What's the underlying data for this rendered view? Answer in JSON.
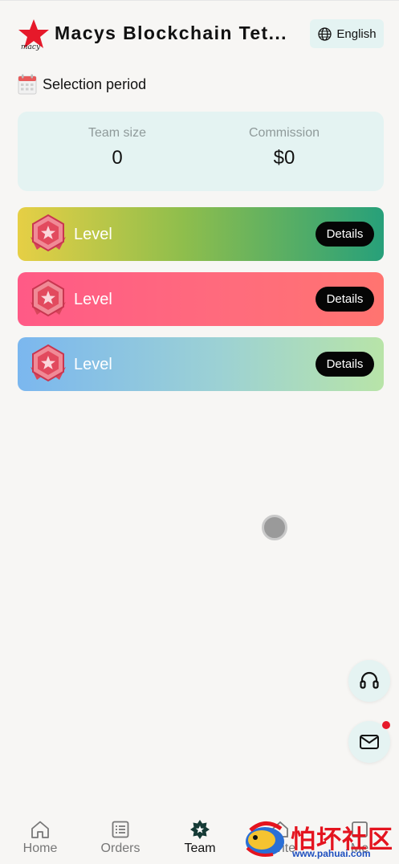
{
  "header": {
    "logo_text": "macy",
    "title": "Macys Blockchain Tet...",
    "language_label": "English"
  },
  "period": {
    "label": "Selection period"
  },
  "stats": {
    "team_size_label": "Team size",
    "team_size_value": "0",
    "commission_label": "Commission",
    "commission_value": "$0"
  },
  "levels": [
    {
      "label": "Level",
      "button": "Details",
      "colors": [
        "#e6cf45",
        "#27a07a"
      ]
    },
    {
      "label": "Level",
      "button": "Details",
      "colors": [
        "#ff5a86",
        "#ff7470"
      ]
    },
    {
      "label": "Level",
      "button": "Details",
      "colors": [
        "#7bb7ef",
        "#b8e4a8"
      ]
    }
  ],
  "floating": {
    "support_icon": "headset-icon",
    "mail_icon": "mail-icon",
    "mail_has_notification": true
  },
  "nav": {
    "items": [
      {
        "label": "Home",
        "icon": "home-icon"
      },
      {
        "label": "Orders",
        "icon": "orders-icon"
      },
      {
        "label": "Team",
        "icon": "team-icon",
        "active": true
      },
      {
        "label": "Invite",
        "icon": "invite-icon"
      },
      {
        "label": "Me",
        "icon": "me-icon"
      }
    ]
  },
  "watermark": {
    "title": "怕坏社区",
    "url": "www.pahuai.com"
  },
  "colors": {
    "accent_bg": "#e4f3f2",
    "brand_red": "#e6192a"
  }
}
